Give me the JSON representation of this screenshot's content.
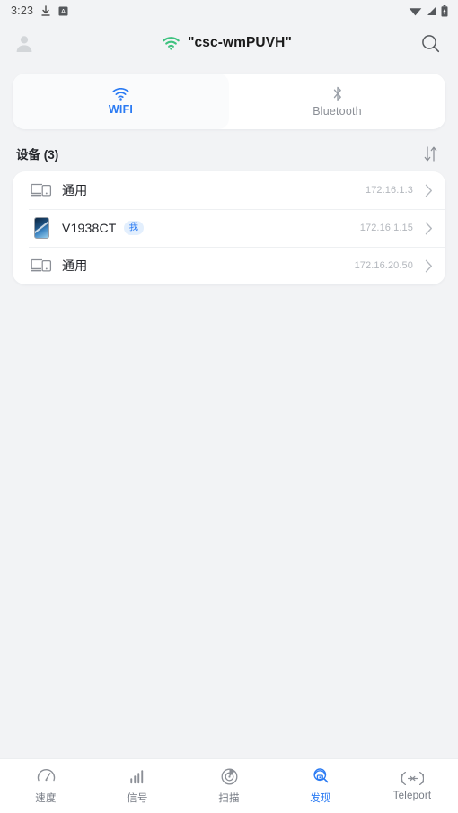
{
  "status_bar": {
    "time": "3:23",
    "left_icons": [
      "download-icon",
      "app-badge-a-icon"
    ],
    "right_icons": [
      "wifi-icon",
      "cellular-signal-icon",
      "battery-icon"
    ]
  },
  "header": {
    "avatar_icon": "user-avatar-icon",
    "wifi_icon": "wifi-connected-icon",
    "title": "\"csc-wmPUVH\"",
    "search_icon": "search-icon",
    "wifi_icon_color": "#3ec27f"
  },
  "tabs": [
    {
      "label": "WIFI",
      "icon": "wifi-icon",
      "active": true
    },
    {
      "label": "Bluetooth",
      "icon": "bluetooth-icon",
      "active": false
    }
  ],
  "section": {
    "title": "设备 (3)",
    "sort_icon": "sort-arrows-icon"
  },
  "devices": [
    {
      "icon": "generic-device-icon",
      "name": "通用",
      "badge": "",
      "ip": "172.16.1.3",
      "chevron": "chevron-right-icon"
    },
    {
      "icon": "phone-thumbnail-icon",
      "name": "V1938CT",
      "badge": "我",
      "ip": "172.16.1.15",
      "chevron": "chevron-right-icon"
    },
    {
      "icon": "generic-device-icon",
      "name": "通用",
      "badge": "",
      "ip": "172.16.20.50",
      "chevron": "chevron-right-icon"
    }
  ],
  "bottom_nav": [
    {
      "label": "速度",
      "icon": "speedometer-icon",
      "active": false
    },
    {
      "label": "信号",
      "icon": "signal-bars-icon",
      "active": false
    },
    {
      "label": "扫描",
      "icon": "radar-scan-icon",
      "active": false
    },
    {
      "label": "发现",
      "icon": "discover-radar-icon",
      "active": true
    },
    {
      "label": "Teleport",
      "icon": "teleport-transfer-icon",
      "active": false
    }
  ],
  "colors": {
    "accent": "#2b7bf3",
    "background": "#f2f3f5",
    "card": "#ffffff",
    "muted_text": "#8b8f96"
  }
}
